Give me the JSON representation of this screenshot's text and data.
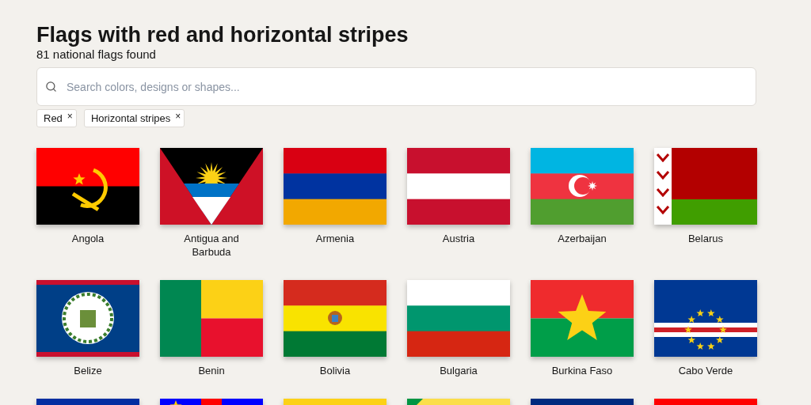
{
  "header": {
    "title": "Flags with red and horizontal stripes",
    "count": "81 national flags found"
  },
  "search": {
    "placeholder": "Search colors, designs or shapes..."
  },
  "filters": [
    {
      "label": "Red",
      "remove": "×"
    },
    {
      "label": "Horizontal stripes",
      "remove": "×"
    }
  ],
  "flags": [
    {
      "name": "Angola"
    },
    {
      "name": "Antigua and Barbuda"
    },
    {
      "name": "Armenia"
    },
    {
      "name": "Austria"
    },
    {
      "name": "Azerbaijan"
    },
    {
      "name": "Belarus"
    },
    {
      "name": "Belize"
    },
    {
      "name": "Benin"
    },
    {
      "name": "Bolivia"
    },
    {
      "name": "Bulgaria"
    },
    {
      "name": "Burkina Faso"
    },
    {
      "name": "Cabo Verde"
    }
  ]
}
